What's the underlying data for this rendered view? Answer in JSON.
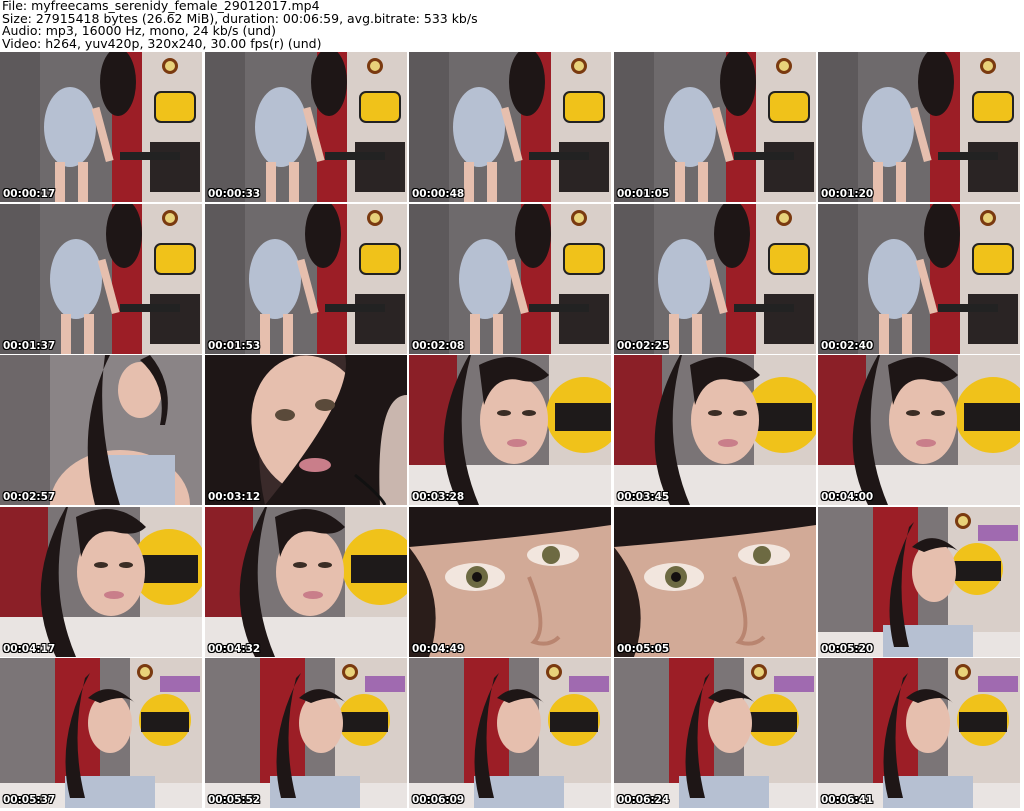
{
  "info": {
    "file": "File: myfreecams_serenidy_female_29012017.mp4",
    "size": "Size: 27915418 bytes (26.62 MiB), duration: 00:06:59, avg.bitrate: 533 kb/s",
    "audio": "Audio: mp3, 16000 Hz, mono, 24 kb/s (und)",
    "video": "Video: h264, yuv420p, 320x240, 30.00 fps(r) (und)"
  },
  "thumbnails": [
    {
      "time": "00:00:17",
      "scene": "standing-wide"
    },
    {
      "time": "00:00:33",
      "scene": "standing-wide"
    },
    {
      "time": "00:00:48",
      "scene": "standing-wide"
    },
    {
      "time": "00:01:05",
      "scene": "standing-wide"
    },
    {
      "time": "00:01:20",
      "scene": "standing-wide"
    },
    {
      "time": "00:01:37",
      "scene": "standing-wide"
    },
    {
      "time": "00:01:53",
      "scene": "standing-wide"
    },
    {
      "time": "00:02:08",
      "scene": "standing-wide"
    },
    {
      "time": "00:02:25",
      "scene": "standing-wide"
    },
    {
      "time": "00:02:40",
      "scene": "standing-wide"
    },
    {
      "time": "00:02:57",
      "scene": "close-body"
    },
    {
      "time": "00:03:12",
      "scene": "face-close"
    },
    {
      "time": "00:03:28",
      "scene": "face-sign"
    },
    {
      "time": "00:03:45",
      "scene": "face-sign"
    },
    {
      "time": "00:04:00",
      "scene": "face-sign"
    },
    {
      "time": "00:04:17",
      "scene": "face-sign"
    },
    {
      "time": "00:04:32",
      "scene": "face-sign"
    },
    {
      "time": "00:04:49",
      "scene": "extreme-close"
    },
    {
      "time": "00:05:05",
      "scene": "extreme-close"
    },
    {
      "time": "00:05:20",
      "scene": "seated-sign"
    },
    {
      "time": "00:05:37",
      "scene": "seated-sign"
    },
    {
      "time": "00:05:52",
      "scene": "seated-sign"
    },
    {
      "time": "00:06:09",
      "scene": "seated-sign"
    },
    {
      "time": "00:06:24",
      "scene": "seated-sign"
    },
    {
      "time": "00:06:41",
      "scene": "seated-sign"
    }
  ],
  "colors": {
    "background": "#ffffff",
    "text": "#000000",
    "timestamp": "#ffffff",
    "curtain": "#6e6a6c",
    "curtain_red": "#9c1e26",
    "brick": "#d9cfc9",
    "sign_yellow": "#f0c21a",
    "skin": "#e6bfae",
    "hair": "#1e1616",
    "dress": "#b6c0d2"
  }
}
